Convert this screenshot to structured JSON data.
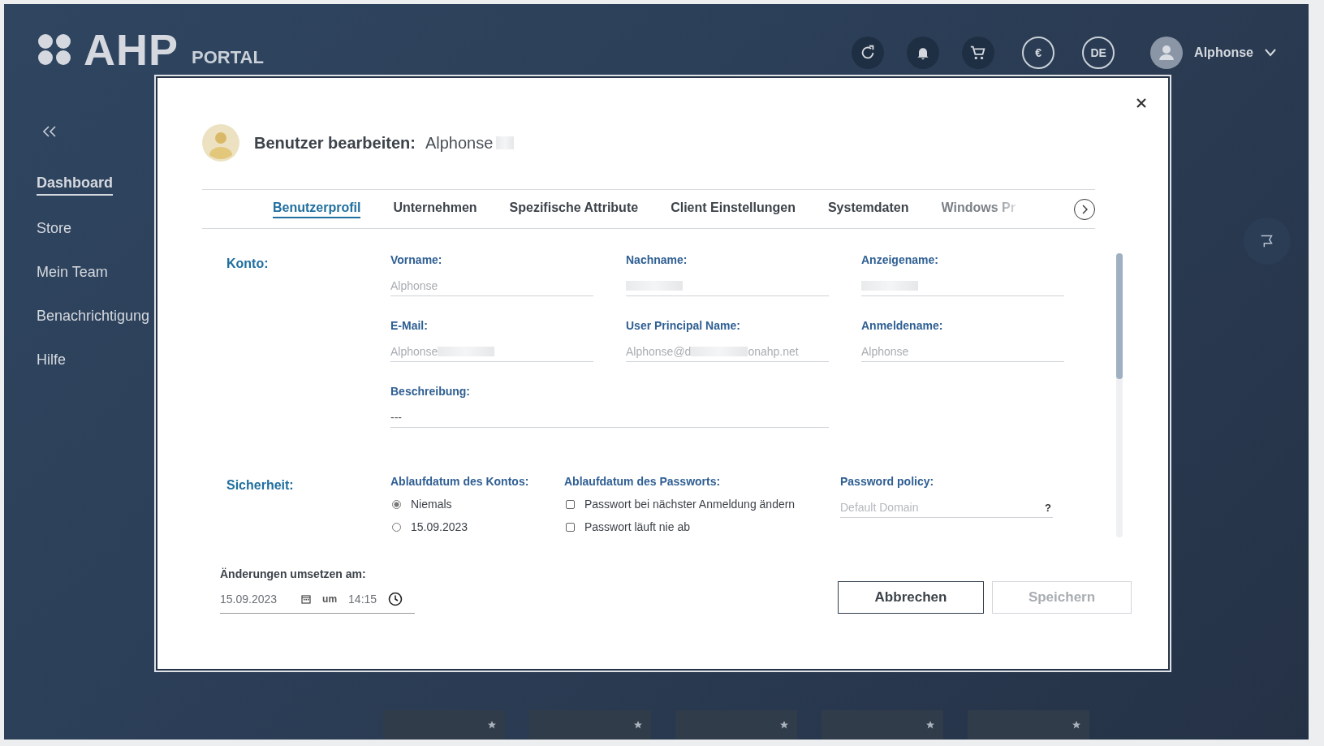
{
  "header": {
    "logo": "AHP",
    "logo_sub": "PORTAL",
    "currency": "€",
    "language": "DE",
    "user": "Alphonse"
  },
  "sidebar": {
    "items": [
      {
        "label": "Dashboard",
        "selected": true
      },
      {
        "label": "Store",
        "selected": false
      },
      {
        "label": "Mein Team",
        "selected": false
      },
      {
        "label": "Benachrichtigung",
        "selected": false
      },
      {
        "label": "Hilfe",
        "selected": false
      }
    ]
  },
  "tiles": [
    {
      "kind": "favorite"
    },
    {
      "kind": "favorite"
    },
    {
      "kind": "favorite"
    },
    {
      "kind": "favorite"
    },
    {
      "kind": "favorite"
    }
  ],
  "dialog": {
    "title": "Benutzer bearbeiten:",
    "user_name": "Alphonse",
    "name_redacted": true,
    "tabs": [
      {
        "label": "Benutzerprofil",
        "selected": true
      },
      {
        "label": "Unternehmen",
        "selected": false
      },
      {
        "label": "Spezifische Attribute",
        "selected": false
      },
      {
        "label": "Client Einstellungen",
        "selected": false
      },
      {
        "label": "Systemdaten",
        "selected": false
      },
      {
        "label": "Windows Pr",
        "selected": false
      }
    ],
    "account": {
      "label": "Konto:",
      "fields": [
        {
          "label": "Vorname:",
          "value": "Alphonse"
        },
        {
          "label": "Nachname:",
          "redacted": true
        },
        {
          "label": "Anzeigename:",
          "redacted": true
        },
        {
          "label": "E-Mail:",
          "value": "Alphonse",
          "redacted": true
        },
        {
          "label": "User Principal Name:",
          "value": "Alphonse@d",
          "redacted": true,
          "value_after": "onahp.net"
        },
        {
          "label": "Anmeldename:",
          "value": "Alphonse"
        },
        {
          "label": "Beschreibung:",
          "value": "---",
          "wide": true
        }
      ]
    },
    "security": {
      "label": "Sicherheit:",
      "account_expiry": {
        "label": "Ablaufdatum des Kontos:",
        "options": [
          {
            "label": "Niemals",
            "selected": true
          },
          {
            "label": "15.09.2023",
            "selected": false
          }
        ]
      },
      "password_expiry": {
        "label": "Ablaufdatum des Passworts:",
        "options": [
          {
            "label": "Passwort bei nächster Anmeldung ändern",
            "checked": false
          },
          {
            "label": "Passwort läuft nie ab",
            "checked": false
          }
        ]
      },
      "policy": {
        "label": "Password policy:",
        "placeholder": "Default Domain",
        "help": "?"
      }
    },
    "apply": {
      "label": "Änderungen umsetzen am:",
      "date": "15.09.2023",
      "at": "um",
      "time": "14:15"
    },
    "buttons": [
      {
        "label": "Abbrechen",
        "disabled": false
      },
      {
        "label": "Speichern",
        "disabled": true
      }
    ]
  }
}
